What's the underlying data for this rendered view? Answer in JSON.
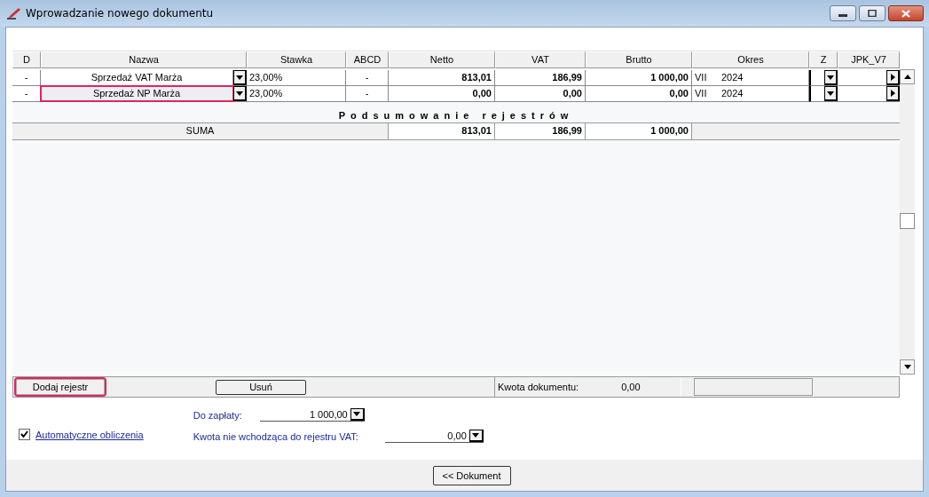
{
  "window": {
    "title": "Wprowadzanie nowego dokumentu"
  },
  "table": {
    "columns": [
      "D",
      "Nazwa",
      "Stawka",
      "ABCD",
      "Netto",
      "VAT",
      "Brutto",
      "Okres",
      "Z",
      "JPK_V7"
    ],
    "rows": [
      {
        "d": "-",
        "nazwa": "Sprzedaż VAT Marża",
        "stawka": "23,00%",
        "abcd": "-",
        "netto": "813,01",
        "vat": "186,99",
        "brutto": "1 000,00",
        "month": "VII",
        "year": "2024",
        "highlighted": false
      },
      {
        "d": "-",
        "nazwa": "Sprzedaż NP Marża",
        "stawka": "23,00%",
        "abcd": "-",
        "netto": "0,00",
        "vat": "0,00",
        "brutto": "0,00",
        "month": "VII",
        "year": "2024",
        "highlighted": true
      }
    ]
  },
  "summary": {
    "title": "Podsumowanie rejestrów",
    "label": "SUMA",
    "netto": "813,01",
    "vat": "186,99",
    "brutto": "1 000,00"
  },
  "actions": {
    "add": {
      "label": "Dodaj rejestr",
      "highlighted": true
    },
    "remove": {
      "label": "Usuń"
    },
    "document_amount_label": "Kwota dokumentu:",
    "document_amount": "0,00"
  },
  "form": {
    "auto_calc": {
      "label": "Automatyczne obliczenia",
      "checked": true
    },
    "to_pay": {
      "label": "Do zapłaty:",
      "value": "1 000,00"
    },
    "non_vat": {
      "label": "Kwota nie wchodząca do rejestru VAT:",
      "value": "0,00"
    }
  },
  "footer": {
    "button": "<< Dokument"
  }
}
